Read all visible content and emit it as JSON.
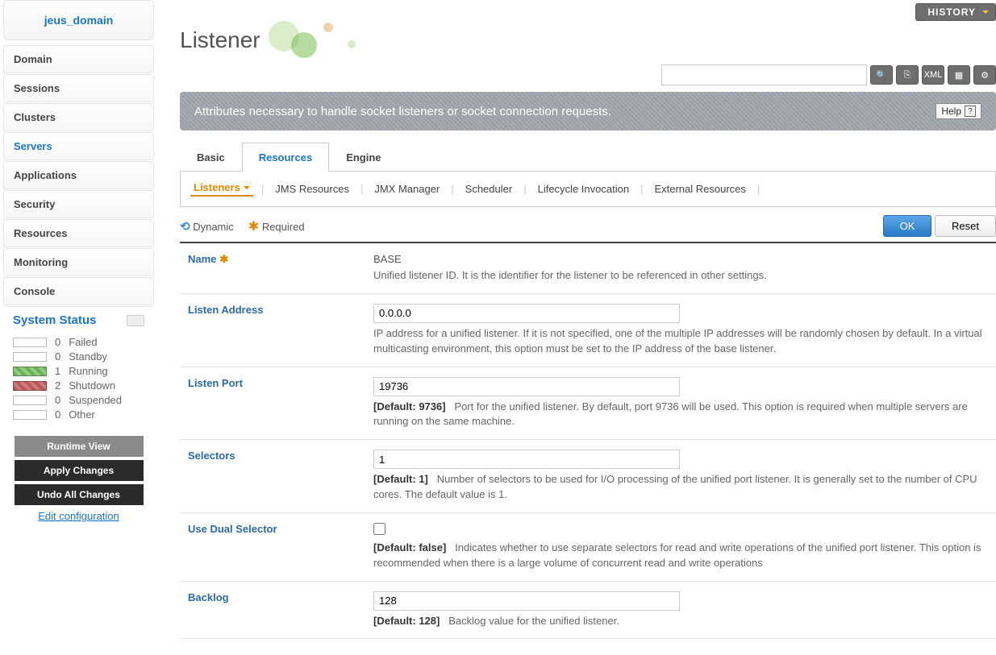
{
  "domain_title": "jeus_domain",
  "nav": [
    "Domain",
    "Sessions",
    "Clusters",
    "Servers",
    "Applications",
    "Security",
    "Resources",
    "Monitoring",
    "Console"
  ],
  "nav_active_index": 3,
  "system_status_title": "System Status",
  "statuses": [
    {
      "count": 0,
      "label": "Failed",
      "cls": ""
    },
    {
      "count": 0,
      "label": "Standby",
      "cls": ""
    },
    {
      "count": 1,
      "label": "Running",
      "cls": "running"
    },
    {
      "count": 2,
      "label": "Shutdown",
      "cls": "shutdown"
    },
    {
      "count": 0,
      "label": "Suspended",
      "cls": ""
    },
    {
      "count": 0,
      "label": "Other",
      "cls": ""
    }
  ],
  "side_buttons": {
    "runtime": "Runtime View",
    "apply": "Apply Changes",
    "undo": "Undo All Changes",
    "edit": "Edit configuration"
  },
  "history_label": "HISTORY",
  "page_title": "Listener",
  "search_placeholder": "",
  "desc_bar": "Attributes necessary to handle socket listeners or socket connection requests.",
  "help_label": "Help",
  "tabs": [
    "Basic",
    "Resources",
    "Engine"
  ],
  "tabs_active_index": 1,
  "subtabs": [
    "Listeners",
    "JMS Resources",
    "JMX Manager",
    "Scheduler",
    "Lifecycle Invocation",
    "External Resources"
  ],
  "subtabs_active_index": 0,
  "legend": {
    "dynamic": "Dynamic",
    "required": "Required"
  },
  "buttons": {
    "ok": "OK",
    "reset": "Reset"
  },
  "fields": {
    "name": {
      "label": "Name",
      "value": "BASE",
      "desc": "Unified listener ID. It is the identifier for the listener to be referenced in other settings.",
      "required": true,
      "static": true
    },
    "listen_address": {
      "label": "Listen Address",
      "value": "0.0.0.0",
      "desc": "IP address for a unified listener. If it is not specified, one of the multiple IP addresses will be randomly chosen by default. In a virtual multicasting environment, this option must be set to the IP address of the base listener."
    },
    "listen_port": {
      "label": "Listen Port",
      "value": "19736",
      "default": "[Default: 9736]",
      "desc": "Port for the unified listener. By default, port 9736 will be used. This option is required when multiple servers are running on the same machine."
    },
    "selectors": {
      "label": "Selectors",
      "value": "1",
      "default": "[Default: 1]",
      "desc": "Number of selectors to be used for I/O processing of the unified port listener. It is generally set to the number of CPU cores. The default value is 1."
    },
    "use_dual": {
      "label": "Use Dual Selector",
      "checked": false,
      "default": "[Default: false]",
      "desc": "Indicates whether to use separate selectors for read and write operations of the unified port listener. This option is recommended when there is a large volume of concurrent read and write operations"
    },
    "backlog": {
      "label": "Backlog",
      "value": "128",
      "default": "[Default: 128]",
      "desc": "Backlog value for the unified listener."
    }
  }
}
